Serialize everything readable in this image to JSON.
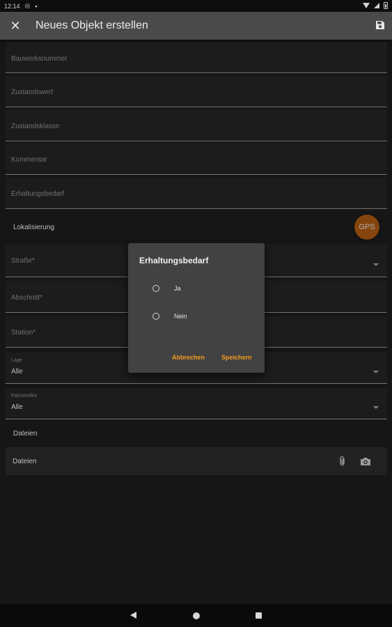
{
  "status_bar": {
    "time": "12:14"
  },
  "app_bar": {
    "title": "Neues Objekt erstellen"
  },
  "form": {
    "bauwerksnummer_placeholder": "Bauwerksnummer",
    "zustandswert_placeholder": "Zustandswert",
    "zustandsklasse_placeholder": "Zustandsklasse",
    "kommentar_placeholder": "Kommentar",
    "erhaltungsbedarf_placeholder": "Erhaltungsbedarf",
    "lokalisierung_label": "Lokalisierung",
    "gps_label": "GPS",
    "strasse_placeholder": "Straße*",
    "abschnitt_placeholder": "Abschnitt*",
    "station_placeholder": "Station*",
    "lage": {
      "label": "Lage",
      "value": "Alle"
    },
    "fahrstreifen": {
      "label": "Fahrstreifen",
      "value": "Alle"
    },
    "dateien_section_label": "Dateien",
    "dateien_row_label": "Dateien"
  },
  "dialog": {
    "title": "Erhaltungsbedarf",
    "options": [
      "Ja",
      "Nein"
    ],
    "cancel_label": "Abbrechen",
    "save_label": "Speichern"
  },
  "colors": {
    "accent": "#f39a1e",
    "gps_button": "#a35510",
    "app_bar": "#4a4a4a",
    "background": "#1b1b1b",
    "dialog": "#424242"
  }
}
